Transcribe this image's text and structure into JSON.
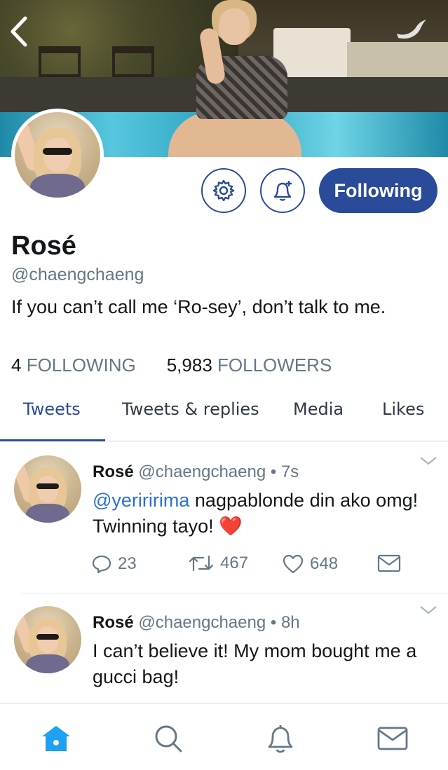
{
  "nav": {
    "back_icon": "chevron-left-icon",
    "bird_icon": "twitter-bird-icon"
  },
  "profile": {
    "display_name": "Rosé",
    "handle": "@chaengchaeng",
    "bio": "If you can’t call me ‘Ro-sey’, don’t talk to me.",
    "following_count": "4",
    "following_label": "FOLLOWING",
    "followers_count": "5,983",
    "followers_label": "FOLLOWERS"
  },
  "actions": {
    "settings_icon": "gear-icon",
    "notify_icon": "bell-plus-icon",
    "follow_label": "Following"
  },
  "tabs": [
    {
      "label": "Tweets",
      "active": true
    },
    {
      "label": "Tweets & replies",
      "active": false
    },
    {
      "label": "Media",
      "active": false
    },
    {
      "label": "Likes",
      "active": false
    }
  ],
  "tweets": [
    {
      "name": "Rosé",
      "meta": "@chaengchaeng • 7s",
      "mention": "@yeriririma",
      "text": " nagpablonde din ako omg! Twinning tayo! ❤️",
      "replies": "23",
      "retweets": "467",
      "likes": "648"
    },
    {
      "name": "Rosé",
      "meta": "@chaengchaeng • 8h",
      "mention": "",
      "text": "I can’t believe it! My mom bought me a gucci bag!"
    }
  ],
  "bottom_nav": [
    "home-icon",
    "search-icon",
    "bell-icon",
    "mail-icon"
  ],
  "colors": {
    "accent": "#2a4a9a",
    "link": "#2a6fd6",
    "muted": "#657786",
    "home_active": "#1da1f2"
  }
}
